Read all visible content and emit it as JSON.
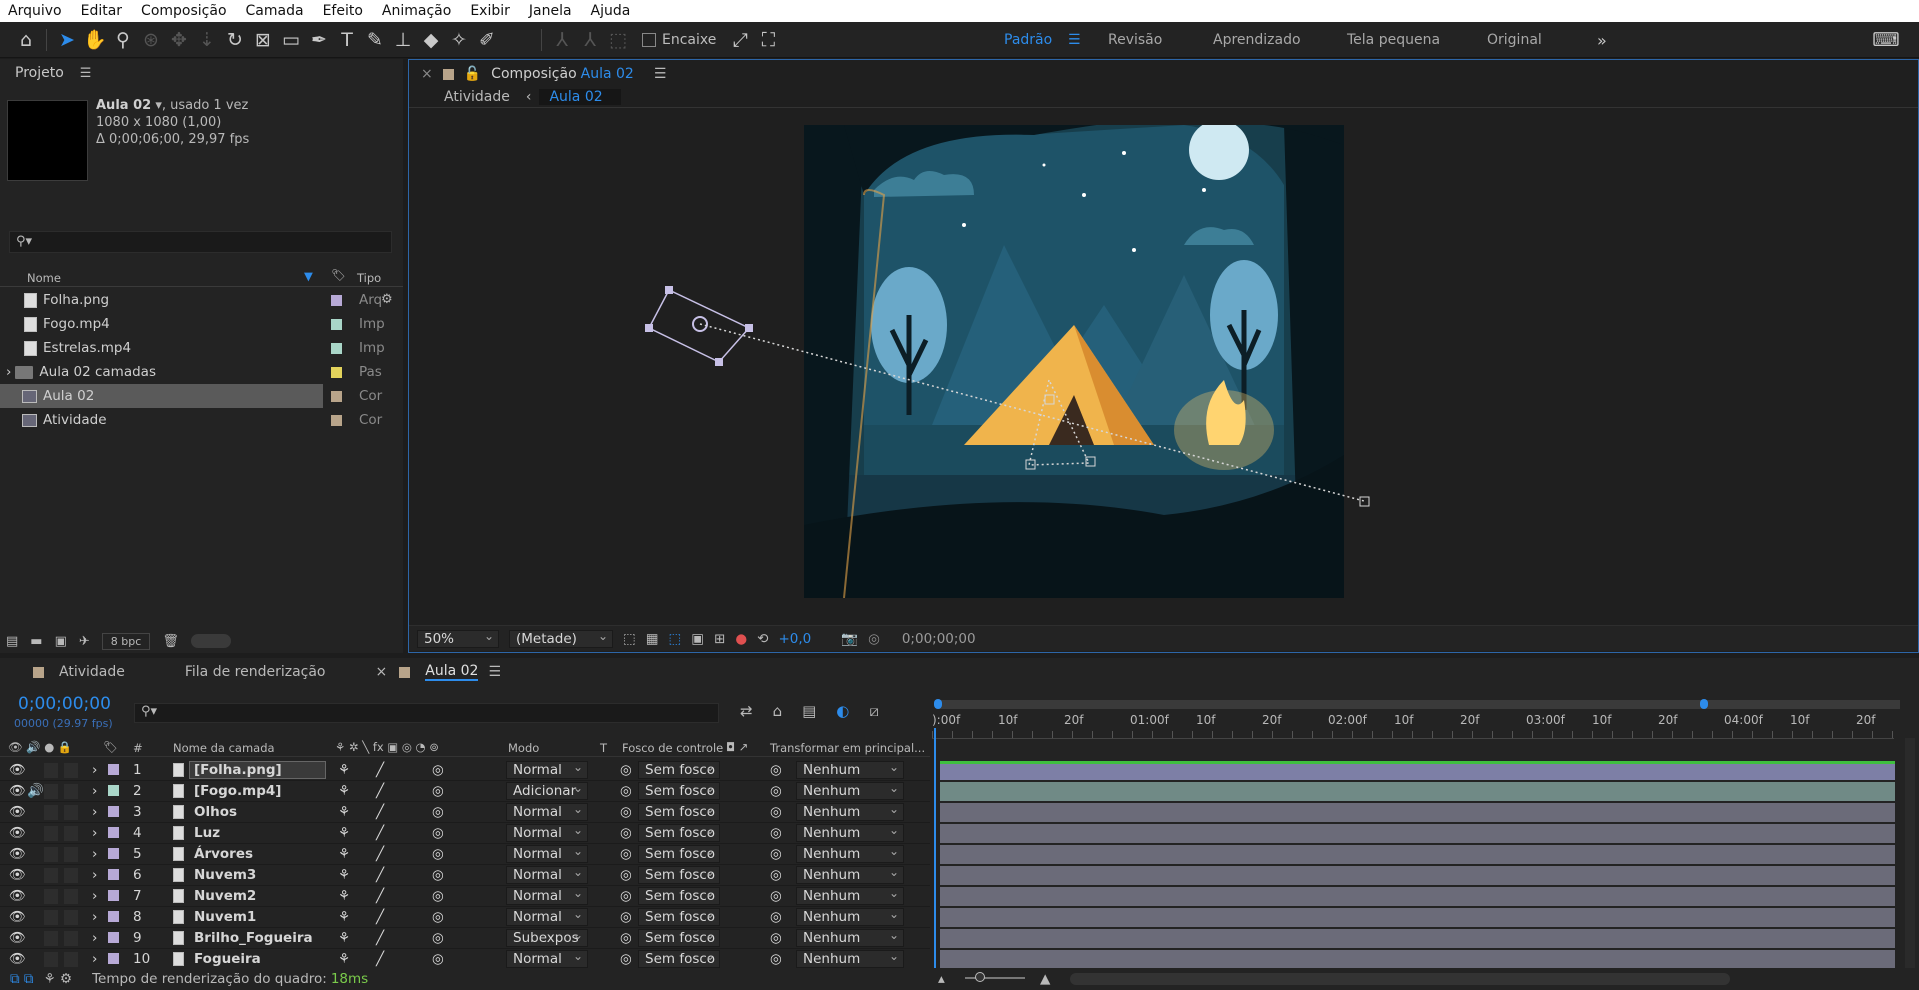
{
  "menu": [
    "Arquivo",
    "Editar",
    "Composição",
    "Camada",
    "Efeito",
    "Animação",
    "Exibir",
    "Janela",
    "Ajuda"
  ],
  "toolbar": {
    "snap_label": "Encaixe"
  },
  "workspaces": [
    {
      "label": "Padrão",
      "active": true
    },
    {
      "label": "Revisão",
      "active": false
    },
    {
      "label": "Aprendizado",
      "active": false
    },
    {
      "label": "Tela pequena",
      "active": false
    },
    {
      "label": "Original",
      "active": false
    }
  ],
  "project": {
    "title": "Projeto",
    "item_name": "Aula 02",
    "item_used": ", usado 1 vez",
    "item_size": "1080 x 1080 (1,00)",
    "item_duration": "Δ 0;00;06;00, 29,97 fps",
    "col_name": "Nome",
    "col_type": "Tipo",
    "items": [
      {
        "name": "Folha.png",
        "type": "Arq",
        "color": "#b7a9d6",
        "icon": "image-file-icon"
      },
      {
        "name": "Fogo.mp4",
        "type": "Imp",
        "color": "#a9d6c8",
        "icon": "video-file-icon"
      },
      {
        "name": "Estrelas.mp4",
        "type": "Imp",
        "color": "#a9d6c8",
        "icon": "video-file-icon"
      },
      {
        "name": "Aula 02 camadas",
        "type": "Pas",
        "color": "#e3d35c",
        "icon": "folder-icon"
      },
      {
        "name": "Aula 02",
        "type": "Cor",
        "color": "#b8a48a",
        "icon": "composition-icon"
      },
      {
        "name": "Atividade",
        "type": "Cor",
        "color": "#b8a48a",
        "icon": "composition-icon"
      }
    ],
    "bpc": "8 bpc"
  },
  "comp": {
    "panel_label": "Composição",
    "name": "Aula 02",
    "breadcrumb_parent": "Atividade",
    "breadcrumb_current": "Aula 02",
    "zoom": "50%",
    "resolution": "(Metade)",
    "exposure": "+0,0",
    "timecode": "0;00;00;00"
  },
  "timeline": {
    "tabs": [
      "Atividade",
      "Fila de renderização",
      "Aula 02"
    ],
    "timecode": "0;00;00;00",
    "fps": "00000 (29.97 fps)",
    "headers": {
      "name": "Nome da camada",
      "mode": "Modo",
      "t": "T",
      "matte": "Fosco de controle",
      "parent": "Transformar em principal..."
    },
    "ruler": [
      "):00f",
      "10f",
      "20f",
      "01:00f",
      "10f",
      "20f",
      "02:00f",
      "10f",
      "20f",
      "03:00f",
      "10f",
      "20f",
      "04:00f",
      "10f",
      "20f"
    ],
    "layers": [
      {
        "num": "1",
        "name": "[Folha.png]",
        "mode": "Normal",
        "matte": "Sem fosco",
        "parent": "Nenhum",
        "color": "#b7a9d6",
        "selected": true
      },
      {
        "num": "2",
        "name": "[Fogo.mp4]",
        "mode": "Adicionar",
        "matte": "Sem fosco",
        "parent": "Nenhum",
        "color": "#a9d6c8",
        "selected": false
      },
      {
        "num": "3",
        "name": "Olhos",
        "mode": "Normal",
        "matte": "Sem fosco",
        "parent": "Nenhum",
        "color": "#b7a9d6",
        "selected": false
      },
      {
        "num": "4",
        "name": "Luz",
        "mode": "Normal",
        "matte": "Sem fosco",
        "parent": "Nenhum",
        "color": "#b7a9d6",
        "selected": false
      },
      {
        "num": "5",
        "name": "Árvores",
        "mode": "Normal",
        "matte": "Sem fosco",
        "parent": "Nenhum",
        "color": "#b7a9d6",
        "selected": false
      },
      {
        "num": "6",
        "name": "Nuvem3",
        "mode": "Normal",
        "matte": "Sem fosco",
        "parent": "Nenhum",
        "color": "#b7a9d6",
        "selected": false
      },
      {
        "num": "7",
        "name": "Nuvem2",
        "mode": "Normal",
        "matte": "Sem fosco",
        "parent": "Nenhum",
        "color": "#b7a9d6",
        "selected": false
      },
      {
        "num": "8",
        "name": "Nuvem1",
        "mode": "Normal",
        "matte": "Sem fosco",
        "parent": "Nenhum",
        "color": "#b7a9d6",
        "selected": false
      },
      {
        "num": "9",
        "name": "Brilho_Fogueira",
        "mode": "Subexpos",
        "matte": "Sem fosco",
        "parent": "Nenhum",
        "color": "#b7a9d6",
        "selected": false
      },
      {
        "num": "10",
        "name": "Fogueira",
        "mode": "Normal",
        "matte": "Sem fosco",
        "parent": "Nenhum",
        "color": "#b7a9d6",
        "selected": false
      }
    ]
  },
  "status": {
    "label": "Tempo de renderização do quadro:",
    "value": "18ms"
  }
}
